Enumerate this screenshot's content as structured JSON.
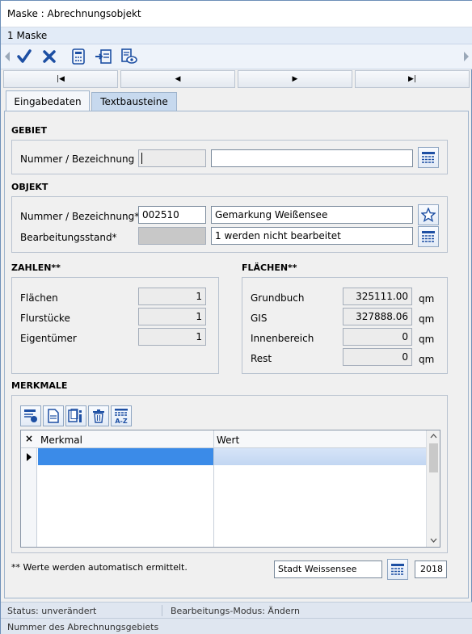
{
  "window": {
    "title": "Maske : Abrechnungsobjekt"
  },
  "menu": {
    "item": "1 Maske"
  },
  "toolbar": {
    "icons": [
      "check-icon",
      "cross-icon",
      "calculator-icon",
      "export-icon",
      "preview-icon"
    ]
  },
  "nav": {
    "first": "|◀",
    "prev": "◀",
    "next": "▶",
    "last": "▶|"
  },
  "tabs": [
    {
      "label": "Eingabedaten"
    },
    {
      "label": "Textbausteine"
    }
  ],
  "gebiet": {
    "title": "GEBIET",
    "label": "Nummer / Bezeichnung",
    "number": "",
    "name": ""
  },
  "objekt": {
    "title": "OBJEKT",
    "label_nummer": "Nummer / Bezeichnung*",
    "nummer": "002510",
    "bezeichnung": "Gemarkung Weißensee",
    "label_stand": "Bearbeitungsstand*",
    "stand_code": "",
    "stand": "1 werden nicht bearbeitet"
  },
  "zahlen": {
    "title": "ZAHLEN**",
    "rows": [
      {
        "label": "Flächen",
        "value": "1"
      },
      {
        "label": "Flurstücke",
        "value": "1"
      },
      {
        "label": "Eigentümer",
        "value": "1"
      }
    ]
  },
  "flaechen": {
    "title": "FLÄCHEN**",
    "unit": "qm",
    "rows": [
      {
        "label": "Grundbuch",
        "value": "325111.00"
      },
      {
        "label": "GIS",
        "value": "327888.06"
      },
      {
        "label": "Innenbereich",
        "value": "0"
      },
      {
        "label": "Rest",
        "value": "0"
      }
    ]
  },
  "merkmale": {
    "title": "MERKMALE",
    "col_close": "×",
    "col1": "Merkmal",
    "col2": "Wert"
  },
  "footer": {
    "note": "** Werte werden automatisch  ermittelt.",
    "ort": "Stadt Weissensee",
    "jahr": "2018"
  },
  "status": {
    "left": "Status: unverändert",
    "mode": "Bearbeitungs-Modus: Ändern",
    "hint": "Nummer des Abrechnungsgebiets"
  },
  "colors": {
    "accent": "#1d4fa3",
    "selection": "#3b8be8"
  }
}
